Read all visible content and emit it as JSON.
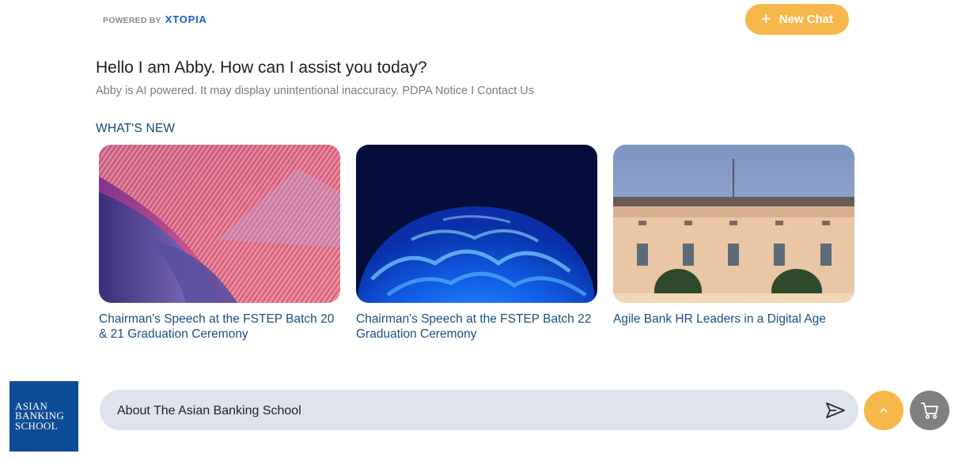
{
  "header": {
    "powered_by": "POWERED BY",
    "brand": "XTOPIA",
    "new_chat_label": "New Chat"
  },
  "greeting": {
    "title": "Hello I am Abby. How can I assist you today?",
    "disclaimer": "Abby is AI powered. It may display unintentional inaccuracy.",
    "pdpa_link": "PDPA Notice",
    "separator": "I",
    "contact_link": "Contact Us"
  },
  "whats_new": {
    "heading": "WHAT'S NEW",
    "cards": [
      {
        "title": "Chairman's Speech at the FSTEP Batch 20 & 21 Graduation Ceremony",
        "image": "pink-abstract-architecture-image"
      },
      {
        "title": "Chairman's Speech at the FSTEP Batch 22 Graduation Ceremony",
        "image": "blue-abstract-sphere-image"
      },
      {
        "title": "Agile Bank HR Leaders in a Digital Age",
        "image": "classical-building-facade-image"
      }
    ]
  },
  "footer": {
    "logo_lines": [
      "ASIAN",
      "BANKING",
      "SCHOOL"
    ],
    "input_value": "About The Asian Banking School",
    "icons": {
      "send": "send-icon",
      "scroll_top": "chevron-up-icon",
      "cart": "cart-icon"
    }
  },
  "colors": {
    "accent": "#f7b84b",
    "link": "#1d4f80",
    "input_bg": "#dfe3ee",
    "logo_bg": "#0d4d96"
  }
}
